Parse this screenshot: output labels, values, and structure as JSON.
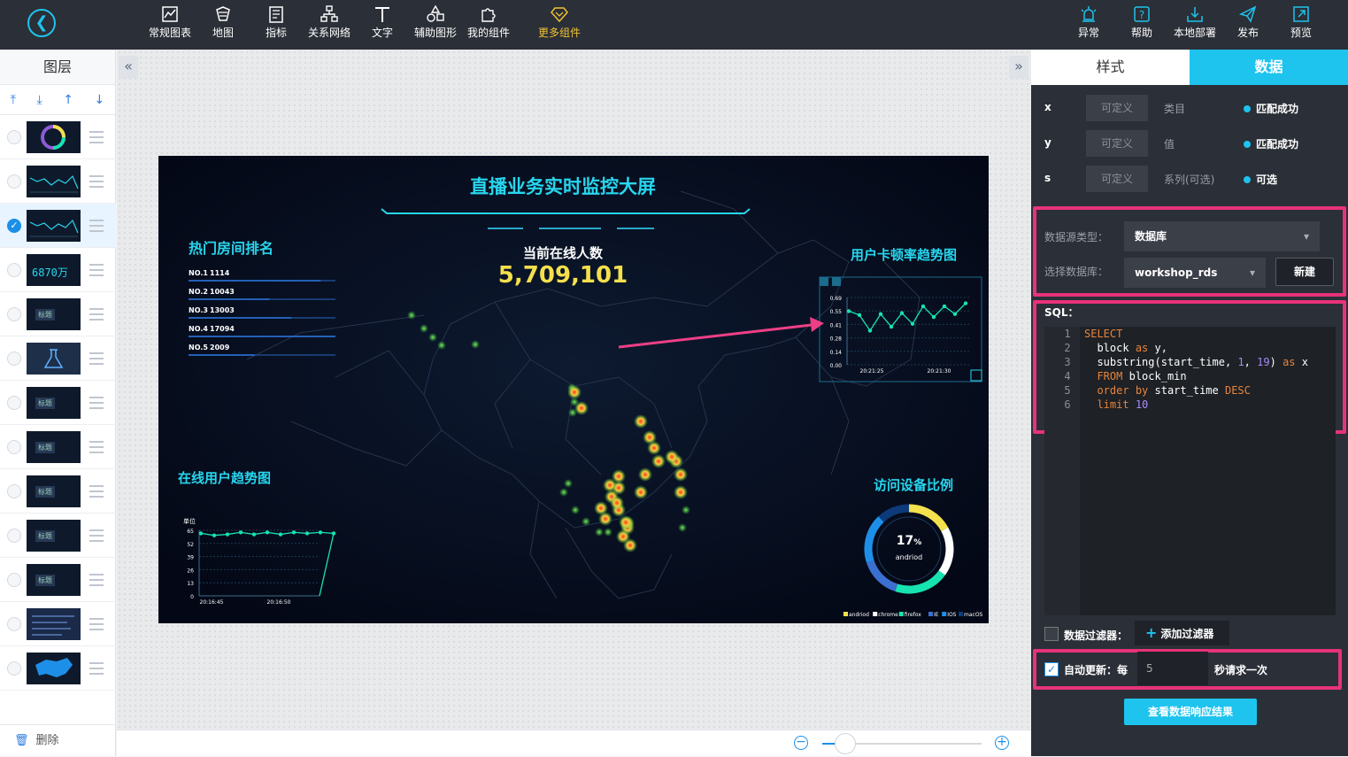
{
  "toolbar": {
    "items": [
      {
        "label": "常规图表",
        "icon": "chart-icon"
      },
      {
        "label": "地图",
        "icon": "map-icon"
      },
      {
        "label": "指标",
        "icon": "indicator-icon"
      },
      {
        "label": "关系网络",
        "icon": "network-icon"
      },
      {
        "label": "文字",
        "icon": "text-icon"
      },
      {
        "label": "辅助图形",
        "icon": "shapes-icon"
      },
      {
        "label": "我的组件",
        "icon": "puzzle-icon"
      },
      {
        "label": "更多组件",
        "icon": "diamond-icon"
      }
    ],
    "right": [
      {
        "label": "异常",
        "icon": "alarm-icon"
      },
      {
        "label": "帮助",
        "icon": "help-icon"
      },
      {
        "label": "本地部署",
        "icon": "download-icon"
      },
      {
        "label": "发布",
        "icon": "send-icon"
      },
      {
        "label": "预览",
        "icon": "preview-icon"
      }
    ]
  },
  "layers": {
    "title": "图层",
    "delete_label": "删除",
    "thumb_tag": "标题",
    "thumb_number": "6870万"
  },
  "screen": {
    "title": "直播业务实时监控大屏",
    "online_label": "当前在线人数",
    "online_value": "5,709,101",
    "ranking": {
      "title": "热门房间排名",
      "rows": [
        {
          "no": "NO.1",
          "val": "1114"
        },
        {
          "no": "NO.2",
          "val": "10043"
        },
        {
          "no": "NO.3",
          "val": "13003"
        },
        {
          "no": "NO.4",
          "val": "17094"
        },
        {
          "no": "NO.5",
          "val": "2009"
        }
      ]
    },
    "lag_chart": {
      "title": "用户卡顿率趋势图",
      "yticks": [
        "0.69",
        "0.55",
        "0.41",
        "0.28",
        "0.14",
        "0.00"
      ],
      "xticks": [
        "20:21:25",
        "20:21:30"
      ],
      "values": [
        0.55,
        0.51,
        0.35,
        0.52,
        0.39,
        0.53,
        0.42,
        0.6,
        0.49,
        0.6,
        0.52,
        0.63
      ]
    },
    "online_chart": {
      "title": "在线用户趋势图",
      "unit": "单位",
      "yticks": [
        "65",
        "52",
        "39",
        "26",
        "13",
        "0"
      ],
      "xticks": [
        "20:16:45",
        "20:16:50"
      ],
      "values": [
        62,
        60,
        61,
        63,
        61,
        63,
        61,
        63,
        62,
        63,
        62,
        0
      ]
    },
    "device": {
      "title": "访问设备比例",
      "percent": "17",
      "percent_unit": "%",
      "label": "andriod",
      "legend": [
        "andriod",
        "chrome",
        "firefox",
        "IE",
        "IOS",
        "macOS"
      ],
      "colors": [
        "#f4e04d",
        "#ffffff",
        "#17e3b1",
        "#3b6fd0",
        "#1e8fe8",
        "#0c3a7a"
      ],
      "ratios": [
        17,
        18,
        20,
        15,
        18,
        12
      ]
    }
  },
  "panel": {
    "tab_style": "样式",
    "tab_data": "数据",
    "mappings": [
      {
        "key": "x",
        "placeholder": "可定义",
        "category": "类目",
        "status": "匹配成功"
      },
      {
        "key": "y",
        "placeholder": "可定义",
        "category": "值",
        "status": "匹配成功"
      },
      {
        "key": "s",
        "placeholder": "可定义",
        "category": "系列(可选)",
        "status": "可选"
      }
    ],
    "source_type_label": "数据源类型：",
    "source_type_value": "数据库",
    "db_label": "选择数据库：",
    "db_value": "workshop_rds",
    "new_button": "新建",
    "sql_label": "SQL：",
    "sql_lines": [
      [
        "1",
        "SELECT"
      ],
      [
        "2",
        "  block as y,"
      ],
      [
        "3",
        "  substring(start_time, 1, 19) as x"
      ],
      [
        "4",
        "  FROM block_min"
      ],
      [
        "5",
        "  order by start_time DESC"
      ],
      [
        "6",
        "  limit 10"
      ]
    ],
    "filter_label": "数据过滤器：",
    "add_filter": "添加过滤器",
    "auto_update_label": "自动更新：每",
    "auto_update_value": "5",
    "auto_update_suffix": "秒请求一次",
    "view_result": "查看数据响应结果"
  },
  "colors": {
    "accent": "#1ec3ee",
    "highlight": "#e8327a",
    "sql_keyword": "#e8843a",
    "sql_number": "#a78bfa",
    "screen_title": "#27d6ee",
    "online_value": "#f4e04d"
  }
}
